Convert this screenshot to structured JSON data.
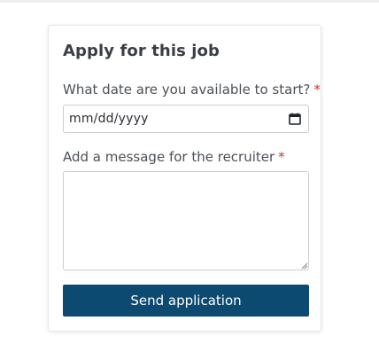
{
  "form": {
    "title": "Apply for this job",
    "date_label": "What date are you available to start?",
    "date_required_mark": "*",
    "date_placeholder": "mm/dd/yyyy",
    "message_label": "Add a message for the recruiter",
    "message_required_mark": "*",
    "message_value": "",
    "submit_label": "Send application"
  },
  "colors": {
    "button": "#0d4a72",
    "required": "#d0312d"
  },
  "icons": {
    "date_picker": "calendar-icon",
    "textarea_corner": "resize-handle-icon"
  }
}
